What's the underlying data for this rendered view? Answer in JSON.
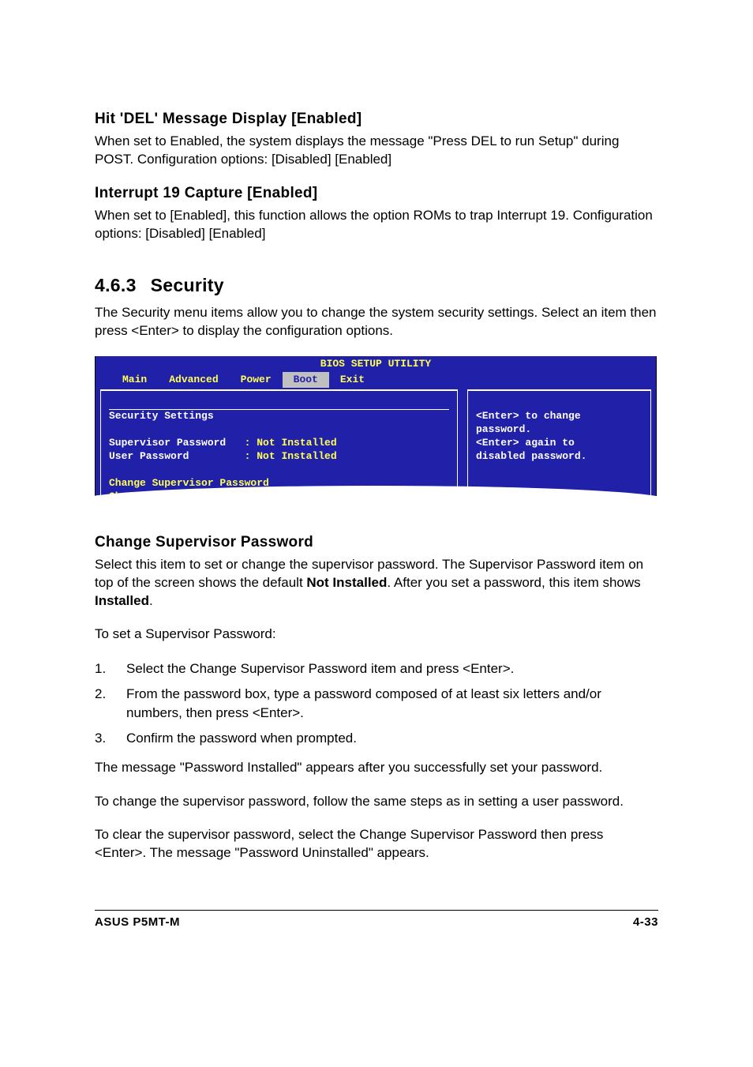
{
  "headings": {
    "hit_del": "Hit 'DEL' Message Display [Enabled]",
    "interrupt": "Interrupt 19 Capture [Enabled]",
    "security_num": "4.6.3",
    "security_title": "Security",
    "change_sup": "Change Supervisor Password"
  },
  "paras": {
    "hit_del_body": "When set to Enabled, the system displays the message \"Press DEL to run Setup\" during POST. Configuration options: [Disabled] [Enabled]",
    "interrupt_body": "When set to [Enabled], this function allows the option ROMs to trap Interrupt 19. Configuration options: [Disabled] [Enabled]",
    "security_intro": "The Security menu items allow you to change the system security settings. Select an item then press <Enter> to display the configuration options.",
    "change_sup_p1a": "Select this item to set or change the supervisor password. The Supervisor Password item on top of the screen shows the default ",
    "change_sup_p1b": "Not Installed",
    "change_sup_p1c": ". After you set a password, this item shows ",
    "change_sup_p1d": "Installed",
    "change_sup_p1e": ".",
    "to_set": "To set a Supervisor Password:",
    "after_set": "The message \"Password Installed\" appears after you successfully set your password.",
    "to_change": "To change the supervisor password, follow the same steps as in setting a user password.",
    "to_clear": "To clear the supervisor password, select the Change Supervisor Password then press <Enter>. The message \"Password Uninstalled\" appears."
  },
  "steps": {
    "s1": "Select the Change Supervisor Password item and press <Enter>.",
    "s2": "From the password box, type a password composed of at least six letters and/or numbers, then press <Enter>.",
    "s3": "Confirm the password when prompted."
  },
  "bios": {
    "title": "BIOS SETUP UTILITY",
    "menu": {
      "main": "Main",
      "advanced": "Advanced",
      "power": "Power",
      "boot": "Boot",
      "exit": "Exit"
    },
    "left": {
      "heading": "Security Settings",
      "row_sup_label": "Supervisor Password",
      "row_sup_value": ": Not Installed",
      "row_user_label": "User Password",
      "row_user_value": ": Not Installed",
      "change_sup": "Change Supervisor Password",
      "change_user": "Change User Password"
    },
    "right": {
      "l1": "<Enter> to change",
      "l2": "password.",
      "l3": "<Enter> again to",
      "l4": "disabled password."
    }
  },
  "footer": {
    "left": "ASUS P5MT-M",
    "right": "4-33"
  }
}
